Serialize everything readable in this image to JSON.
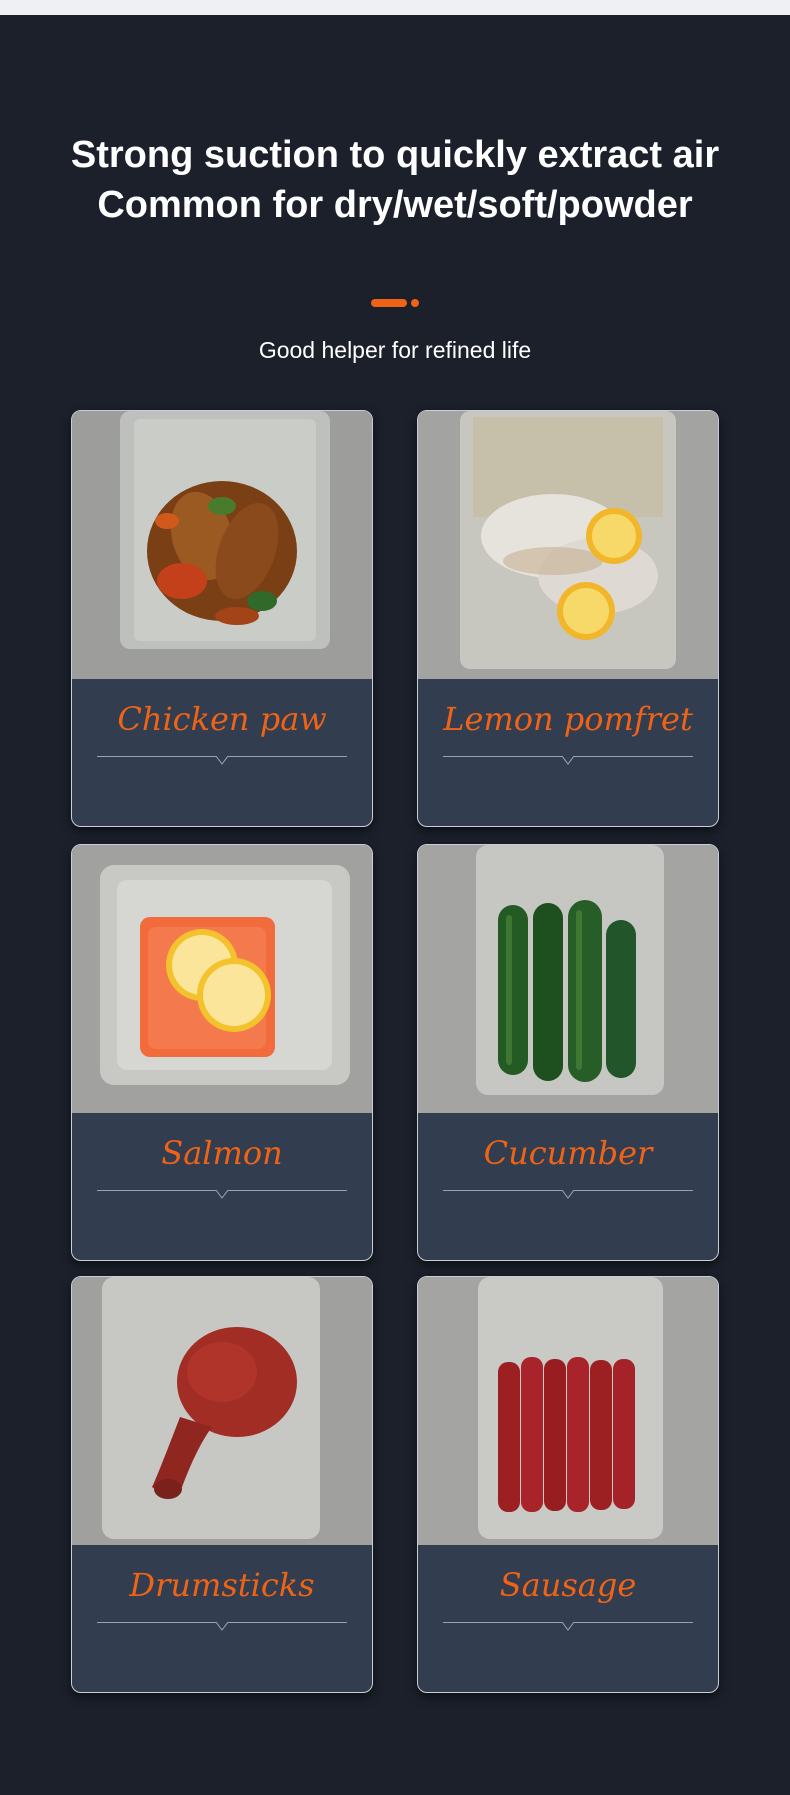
{
  "headline": {
    "line1": "Strong suction to quickly extract air",
    "line2": "Common for dry/wet/soft/powder"
  },
  "subtitle": "Good helper for refined life",
  "colors": {
    "background": "#1b202b",
    "card": "#323d4f",
    "accent": "#ef6316"
  },
  "products": [
    {
      "label": "Chicken paw",
      "image": "vacuum-bag-chicken-paws"
    },
    {
      "label": "Lemon pomfret",
      "image": "vacuum-bag-pomfret-lemon"
    },
    {
      "label": "Salmon",
      "image": "vacuum-bag-salmon-lemon"
    },
    {
      "label": "Cucumber",
      "image": "vacuum-bag-cucumbers"
    },
    {
      "label": "Drumsticks",
      "image": "vacuum-bag-drumstick"
    },
    {
      "label": "Sausage",
      "image": "vacuum-bag-sausages"
    }
  ]
}
